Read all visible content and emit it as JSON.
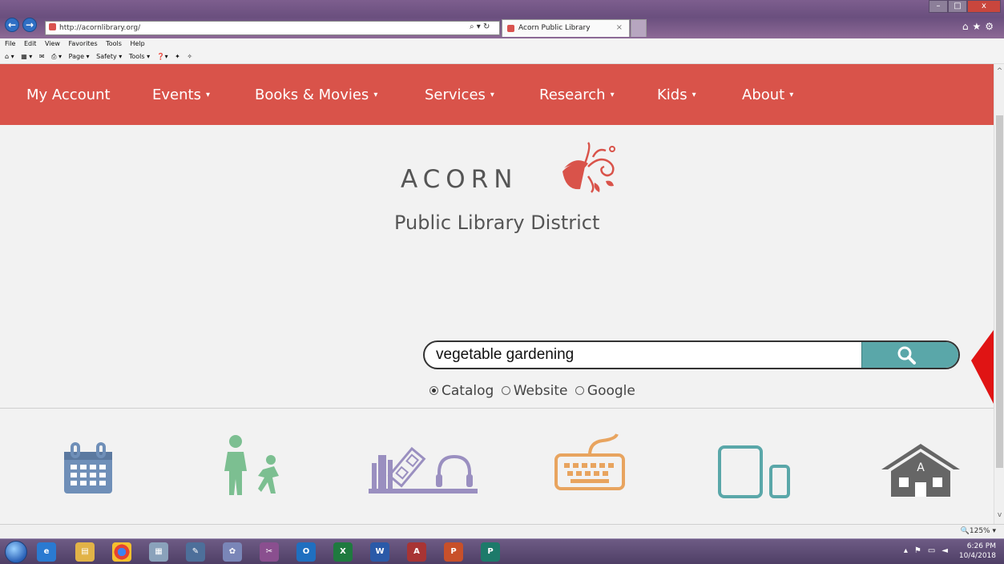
{
  "browser": {
    "address": "http://acornlibrary.org/",
    "address_tools": "⌕ ▾ ↻",
    "tab_title": "Acorn Public Library",
    "tab_close": "×",
    "menu": [
      "File",
      "Edit",
      "View",
      "Favorites",
      "Tools",
      "Help"
    ],
    "command_bar": [
      "Page ▾",
      "Safety ▾",
      "Tools ▾"
    ],
    "zoom": "125%",
    "window_buttons": {
      "min": "–",
      "max": "□",
      "close": "x"
    }
  },
  "site_nav": {
    "items": [
      {
        "label": "My Account",
        "has_menu": false
      },
      {
        "label": "Events",
        "has_menu": true
      },
      {
        "label": "Books & Movies",
        "has_menu": true
      },
      {
        "label": "Services",
        "has_menu": true
      },
      {
        "label": "Research",
        "has_menu": true
      },
      {
        "label": "Kids",
        "has_menu": true
      },
      {
        "label": "About",
        "has_menu": true
      }
    ],
    "caret": "▾",
    "background": "#d9534a"
  },
  "brand": {
    "name": "ACORN",
    "subtitle": "Public Library District",
    "accent": "#d9534a"
  },
  "search": {
    "value": "vegetable gardening",
    "button_color": "#5aa7a9",
    "scopes": [
      {
        "label": "Catalog",
        "selected": true
      },
      {
        "label": "Website",
        "selected": false
      },
      {
        "label": "Google",
        "selected": false
      }
    ]
  },
  "quick_links": [
    {
      "icon": "calendar-icon",
      "color": "#6f8fb8"
    },
    {
      "icon": "kids-icon",
      "color": "#7cbf91"
    },
    {
      "icon": "books-movies-icon",
      "color": "#9a8fc0"
    },
    {
      "icon": "keyboard-icon",
      "color": "#e8a45f"
    },
    {
      "icon": "tablet-phone-icon",
      "color": "#5aa7a9"
    },
    {
      "icon": "house-icon",
      "color": "#666666"
    }
  ],
  "taskbar": {
    "time": "6:26 PM",
    "date": "10/4/2018",
    "apps": [
      "start-button",
      "ie-icon",
      "file-explorer-icon",
      "chrome-icon",
      "calculator-icon",
      "notes-icon",
      "paint-icon",
      "snipping-icon",
      "outlook-icon",
      "excel-icon",
      "word-icon",
      "access-icon",
      "powerpoint-icon",
      "publisher-icon"
    ]
  }
}
